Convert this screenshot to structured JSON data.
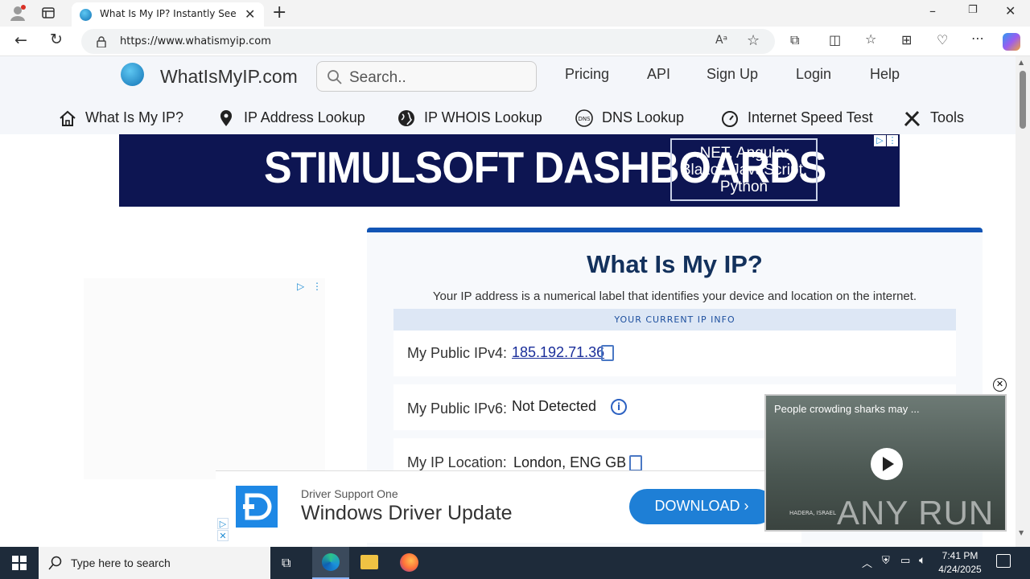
{
  "browser": {
    "tab_title": "What Is My IP? Instantly See Your",
    "url": "https://www.whatismyip.com"
  },
  "site": {
    "logo_text": "WhatIsMyIP.com",
    "search_placeholder": "Search..",
    "top_nav": [
      "Pricing",
      "API",
      "Sign Up",
      "Login",
      "Help"
    ],
    "sub_nav": [
      "What Is My IP?",
      "IP Address Lookup",
      "IP WHOIS Lookup",
      "DNS Lookup",
      "Internet Speed Test",
      "Tools"
    ]
  },
  "banner_ad": {
    "headline": "STIMULSOFT DASHBOARDS",
    "box_lines": [
      ".NET, Angular,",
      "Blazor, JavaScript,",
      "Python"
    ]
  },
  "main": {
    "title": "What Is My IP?",
    "subtitle": "Your IP address is a numerical label that identifies your device and location on the internet.",
    "info_header": "YOUR CURRENT IP INFO",
    "ipv4_label": "My Public IPv4:",
    "ipv4_value": "185.192.71.36",
    "ipv6_label": "My Public IPv6:",
    "ipv6_value": "Not Detected",
    "location_label": "My IP Location:",
    "location_value": "London, ENG GB"
  },
  "bottom_ad": {
    "small": "Driver Support One",
    "big": "Windows Driver Update",
    "button": "DOWNLOAD"
  },
  "video": {
    "title": "People crowding sharks may ...",
    "watermark": "ANY RUN",
    "caption": "HADERA, ISRAEL"
  },
  "taskbar": {
    "search_placeholder": "Type here to search",
    "time": "7:41 PM",
    "date": "4/24/2025"
  }
}
